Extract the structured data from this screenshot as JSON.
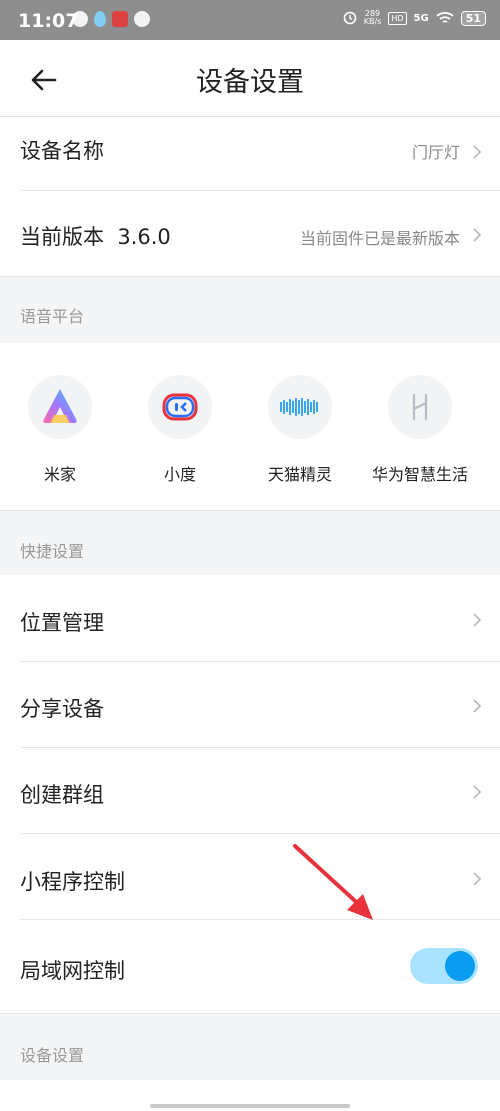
{
  "status_bar": {
    "time": "11:07",
    "speed_value": "289",
    "speed_unit": "KB/s",
    "hd": "HD",
    "network": "5G",
    "battery": "51"
  },
  "header": {
    "title": "设备设置",
    "back_icon": "arrow-left-icon"
  },
  "rows": {
    "device_name": {
      "label": "设备名称",
      "value": "门厅灯"
    },
    "version": {
      "label": "当前版本  3.6.0",
      "value": "当前固件已是最新版本"
    },
    "location": {
      "label": "位置管理"
    },
    "share": {
      "label": "分享设备"
    },
    "group": {
      "label": "创建群组"
    },
    "miniprogram": {
      "label": "小程序控制"
    },
    "lan": {
      "label": "局域网控制",
      "toggle_on": true
    }
  },
  "sections": {
    "voice": "语音平台",
    "quick": "快捷设置",
    "device": "设备设置"
  },
  "voice_platforms": [
    {
      "name": "米家",
      "icon": "mijia-icon"
    },
    {
      "name": "小度",
      "icon": "xiaodu-icon"
    },
    {
      "name": "天猫精灵",
      "icon": "tmall-genie-icon"
    },
    {
      "name": "华为智慧生活",
      "icon": "huawei-smart-life-icon"
    }
  ],
  "colors": {
    "accent": "#0a9cf0",
    "toggle_track": "#a9e3ff",
    "annotation_arrow": "#e8323c"
  }
}
